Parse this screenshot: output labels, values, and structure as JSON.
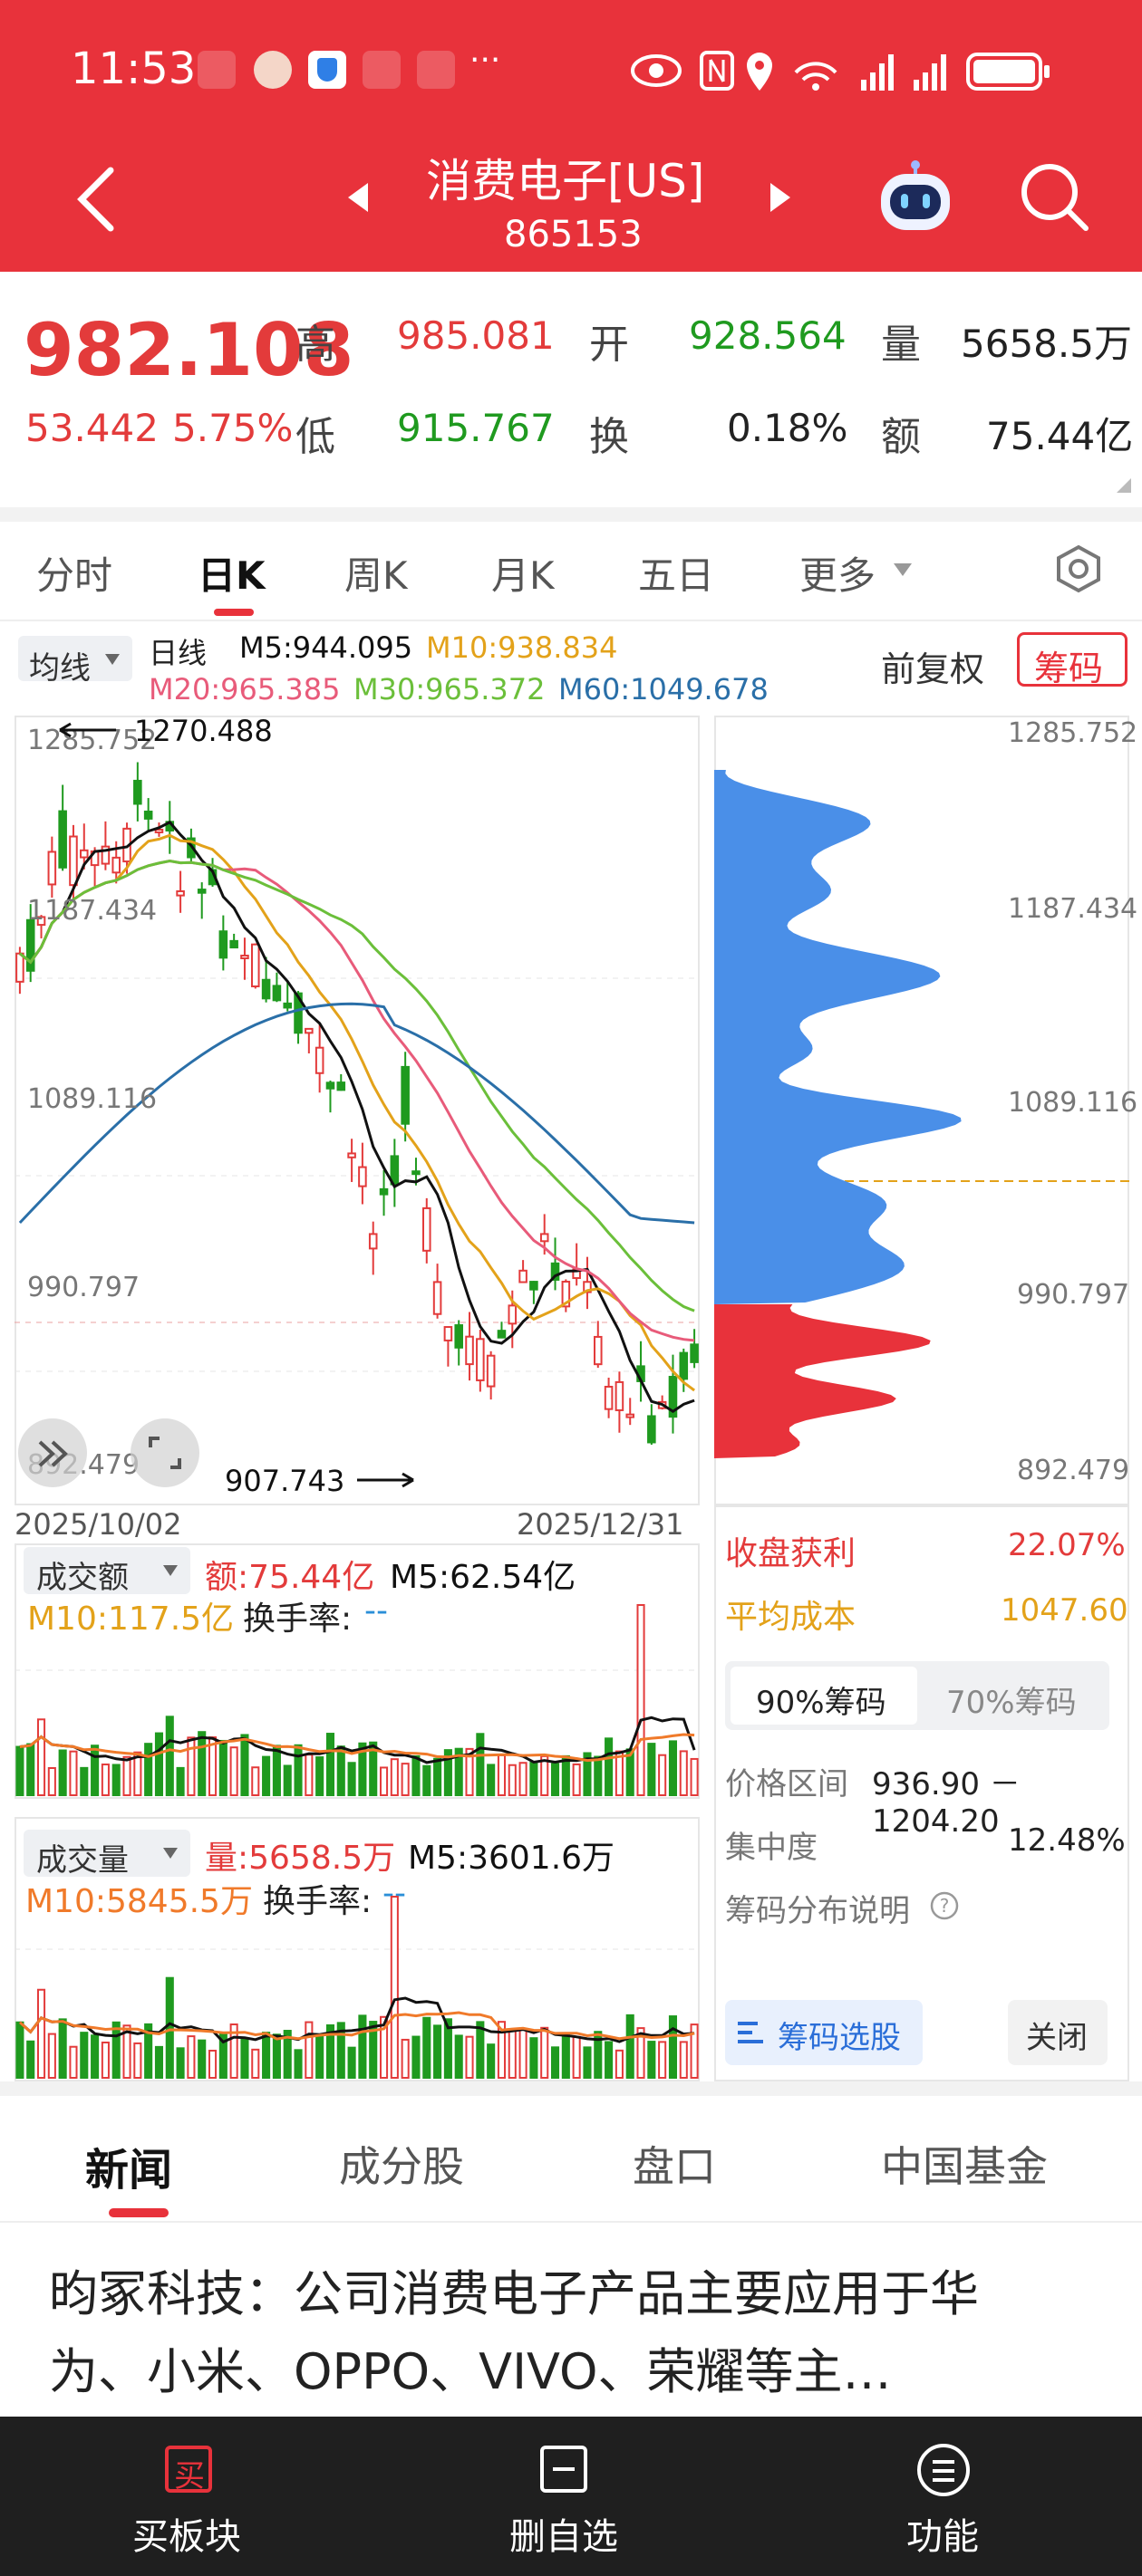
{
  "status": {
    "time": "11:53",
    "extra_icons": "···"
  },
  "header": {
    "title": "消费电子[US]",
    "code": "865153"
  },
  "quote": {
    "price": "982.108",
    "change": "53.442",
    "change_pct": "5.75%",
    "high_label": "高",
    "high": "985.081",
    "low_label": "低",
    "low": "915.767",
    "open_label": "开",
    "open": "928.564",
    "turnover_label": "换",
    "turnover": "0.18%",
    "volume_label": "量",
    "volume": "5658.5万",
    "amount_label": "额",
    "amount": "75.44亿"
  },
  "tabs": [
    "分时",
    "日K",
    "周K",
    "月K",
    "五日",
    "更多"
  ],
  "ma_legend": {
    "selector": "均线",
    "day": "日线",
    "m5": "M5:944.095",
    "m10": "M10:938.834",
    "m20": "M20:965.385",
    "m30": "M30:965.372",
    "m60": "M60:1049.678",
    "adjust": "前复权",
    "chip_btn": "筹码"
  },
  "kline": {
    "max_label": "1270.488",
    "min_label": "907.743",
    "y_ticks": [
      "1285.752",
      "1187.434",
      "1089.116",
      "990.797",
      "892.479"
    ],
    "date_start": "2025/10/02",
    "date_end": "2025/12/31"
  },
  "amount_panel": {
    "selector": "成交额",
    "value": "额:75.44亿",
    "m5": "M5:62.54亿",
    "m10": "M10:117.5亿",
    "turnover": "换手率:",
    "turnover_val": "--"
  },
  "volume_panel": {
    "selector": "成交量",
    "value": "量:5658.5万",
    "m5": "M5:3601.6万",
    "m10": "M10:5845.5万",
    "turnover": "换手率:",
    "turnover_val": "--"
  },
  "chips": {
    "y_ticks": [
      "1285.752",
      "1187.434",
      "1089.116",
      "990.797",
      "892.479"
    ],
    "profit_label": "收盘获利",
    "profit": "22.07%",
    "avg_cost_label": "平均成本",
    "avg_cost": "1047.60",
    "tab_90": "90%筹码",
    "tab_70": "70%筹码",
    "range_label": "价格区间",
    "range": "936.90 － 1204.20",
    "concentration_label": "集中度",
    "concentration": "12.48%",
    "explain": "筹码分布说明",
    "select_btn": "筹码选股",
    "close_btn": "关闭"
  },
  "info_tabs": [
    "新闻",
    "成分股",
    "盘口",
    "中国基金"
  ],
  "news": {
    "headline": "昀冢科技：公司消费电子产品主要应用于华为、小米、OPPO、VIVO、荣耀等主…"
  },
  "bottom_nav": [
    {
      "label": "买板块",
      "icon_char": "买"
    },
    {
      "label": "删自选",
      "icon_char": "一"
    },
    {
      "label": "功能",
      "icon_char": "三"
    }
  ],
  "colors": {
    "header": "#e8323b",
    "up": "#e33b3b",
    "down": "#1f9a1f",
    "chip_profit": "#e8323b",
    "chip_loss": "#4a8fe8"
  }
}
